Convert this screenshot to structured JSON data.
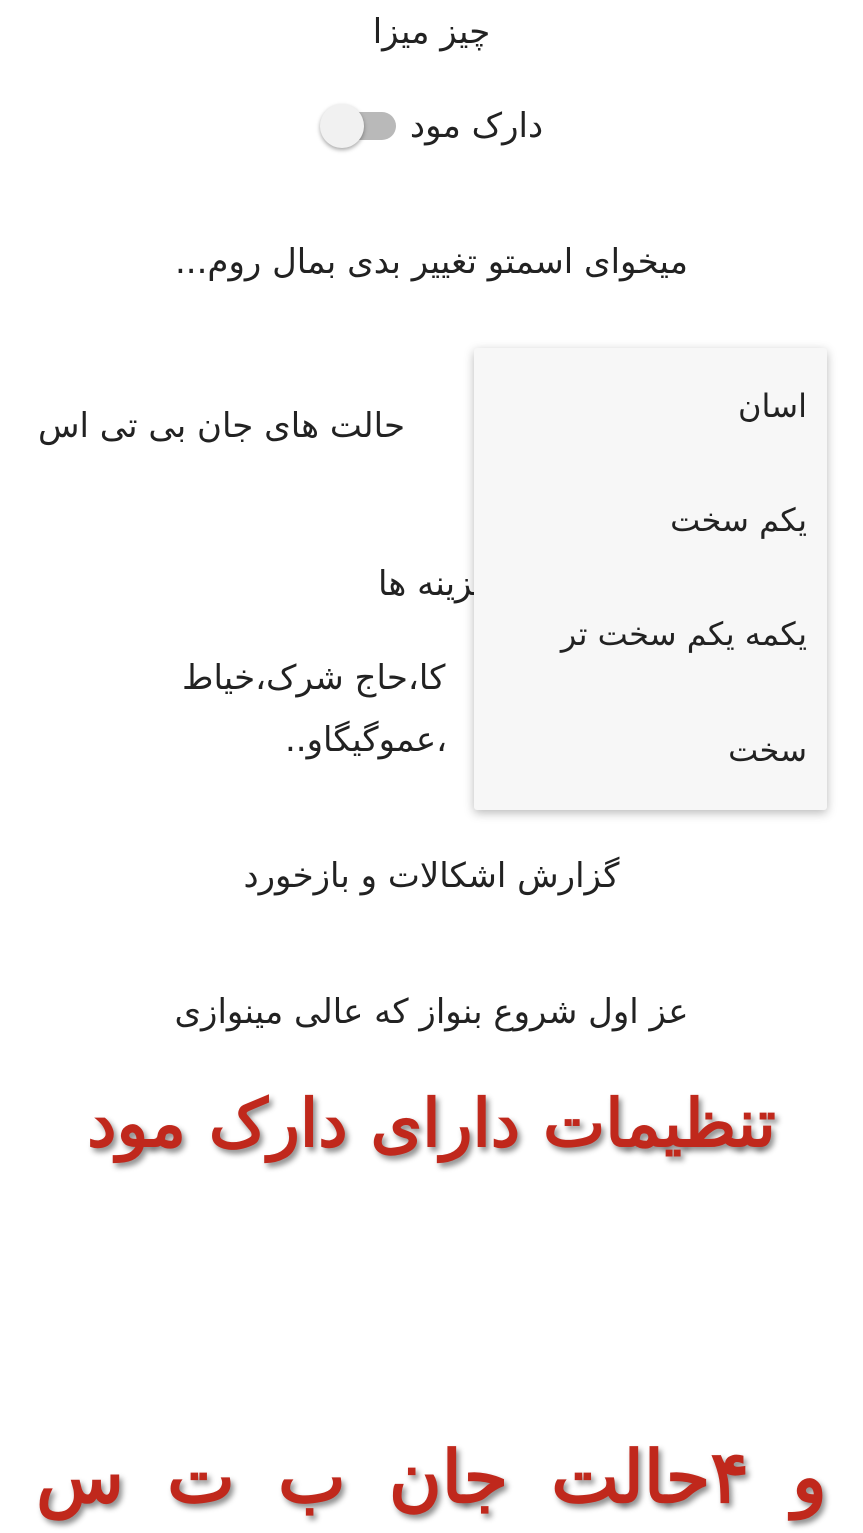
{
  "header": {
    "title": "چیز میزا"
  },
  "settings": {
    "dark_mode_label": "دارک مود",
    "dark_mode_on": false,
    "rename_prompt": "میخوای اسمتو تغییر بدی بمال روم...",
    "modes_label": "حالت های جان بی تی اس",
    "options_heading": "گزینه ها",
    "options_line1": "کا،حاج شرک،خیاط",
    "options_line2": "،عموگیگاو..",
    "report_label": "گزارش اشکالات و بازخورد",
    "start_hint": "عز اول شروع بنواز که عالی مینوازی"
  },
  "dropdown": {
    "items": [
      "اسان",
      "یکم سخت",
      "یکمه یکم سخت تر",
      "سخت"
    ]
  },
  "promo": {
    "line1": "تنظیمات دارای دارک مود",
    "line2": "و ۴حالت جان ب ت س"
  },
  "colors": {
    "promo_text": "#c0281c",
    "switch_track": "#b9b9b9",
    "switch_thumb": "#f1f1f1",
    "menu_background": "#f7f7f7"
  }
}
